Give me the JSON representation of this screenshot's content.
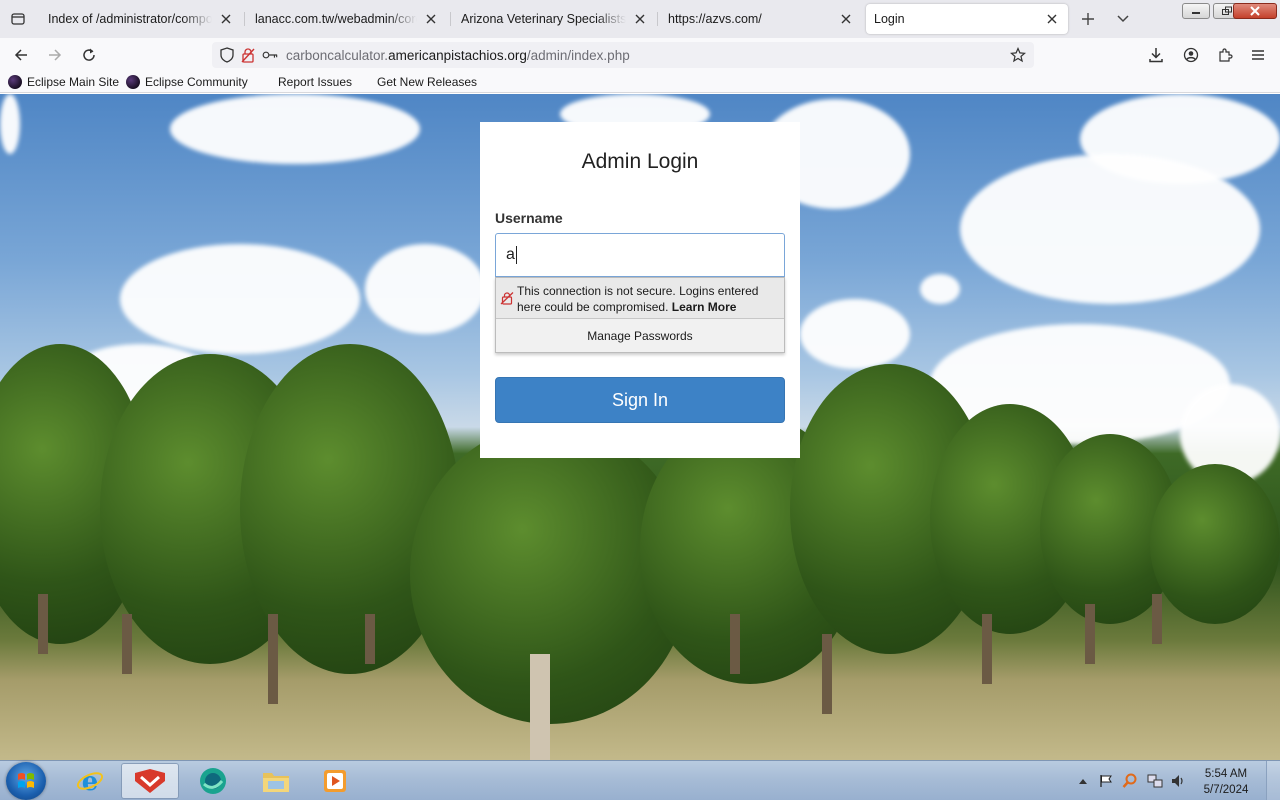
{
  "tabs": [
    {
      "title": "Index of /administrator/compon",
      "active": false
    },
    {
      "title": "lanacc.com.tw/webadmin/core/",
      "active": false
    },
    {
      "title": "Arizona Veterinary Specialists - V",
      "active": false
    },
    {
      "title": "https://azvs.com/",
      "active": false
    },
    {
      "title": "Login",
      "active": true
    }
  ],
  "url": {
    "prefix": "carboncalculator.",
    "host": "americanpistachios.org",
    "path": "/admin/index.php"
  },
  "bookmarks": [
    {
      "label": "Eclipse Main Site",
      "icon": "eclipse-icon"
    },
    {
      "label": "Eclipse Community",
      "icon": "eclipse-icon"
    },
    {
      "label": "Report Issues"
    },
    {
      "label": "Get New Releases"
    }
  ],
  "login": {
    "title": "Admin Login",
    "username_label": "Username",
    "username_value": "a",
    "insecure_message": "This connection is not secure. Logins entered here could be compromised.",
    "learn_more": "Learn More",
    "manage_passwords": "Manage Passwords",
    "sign_in": "Sign In"
  },
  "taskbar": {
    "apps": [
      "internet-explorer",
      "tableau",
      "edge-like",
      "file-explorer",
      "media-player"
    ],
    "time": "5:54 AM",
    "date": "5/7/2024"
  },
  "colors": {
    "accent": "#3d82c6",
    "input_focus": "#7aa6d8",
    "close_button": "#c4412b"
  }
}
